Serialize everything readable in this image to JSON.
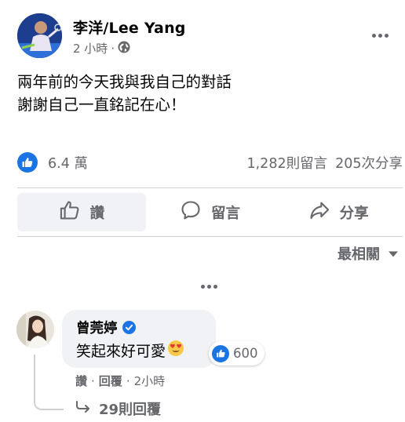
{
  "post": {
    "author": "李洋/Lee Yang",
    "time": "2 小時",
    "separator": "·",
    "text_line1": "兩年前的今天我與我自己的對話",
    "text_line2": "謝謝自己一直銘記在心！"
  },
  "stats": {
    "likes": "6.4 萬",
    "comments": "1,282則留言",
    "shares": "205次分享"
  },
  "actions": {
    "like": "讚",
    "comment": "留言",
    "share": "分享"
  },
  "sort": {
    "label": "最相關"
  },
  "comment": {
    "author": "曾莞婷",
    "text": "笑起來好可愛",
    "reaction_count": "600",
    "like_label": "讚",
    "reply_label": "回覆",
    "time": "2小時",
    "sep": "·",
    "replies_label": "29則回覆"
  },
  "colors": {
    "accent": "#1b74e4",
    "secondary_text": "#65676b",
    "bubble": "#f0f2f5"
  },
  "icons": [
    "globe-icon",
    "more-icon",
    "like-icon",
    "comment-icon",
    "share-icon",
    "chevron-down-icon",
    "verified-icon",
    "heart-eyes-emoji",
    "reply-arrow-icon"
  ]
}
